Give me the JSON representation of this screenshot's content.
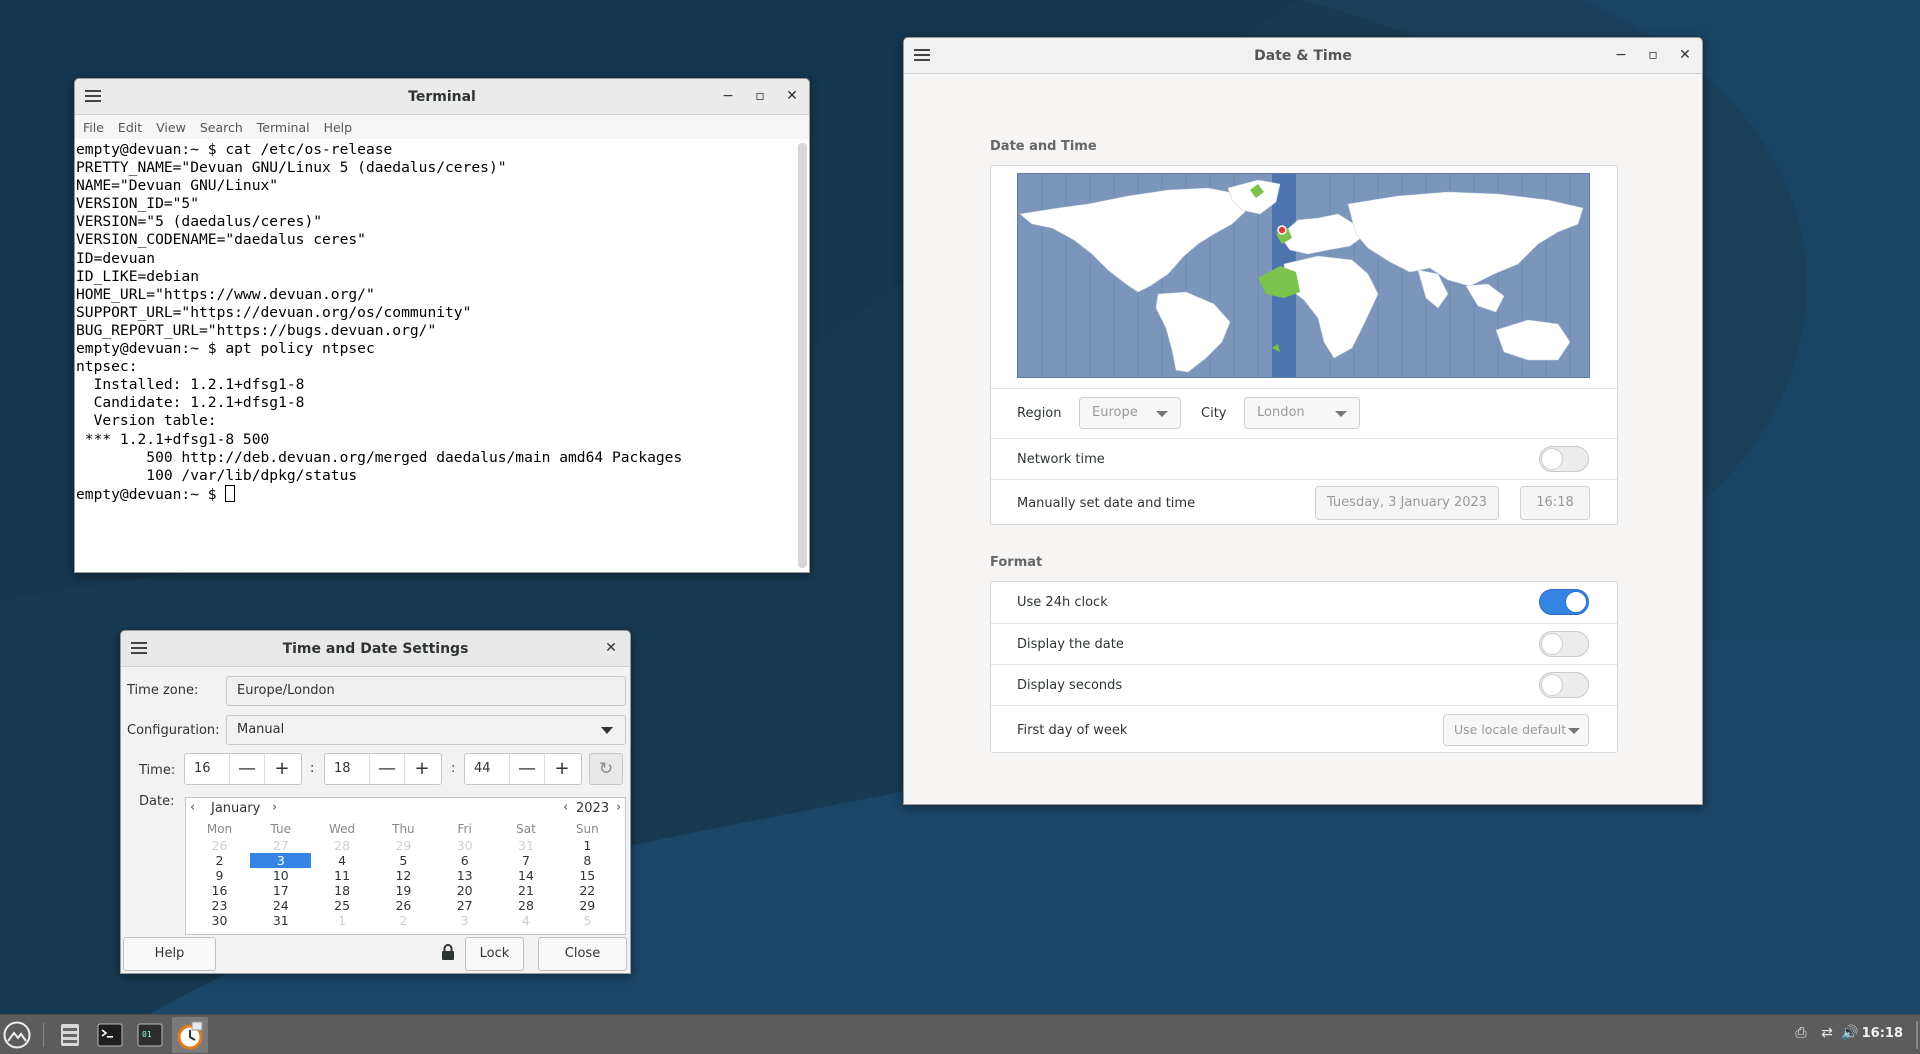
{
  "terminal": {
    "title": "Terminal",
    "menu": [
      "File",
      "Edit",
      "View",
      "Search",
      "Terminal",
      "Help"
    ],
    "lines": [
      "empty@devuan:~ $ cat /etc/os-release",
      "PRETTY_NAME=\"Devuan GNU/Linux 5 (daedalus/ceres)\"",
      "NAME=\"Devuan GNU/Linux\"",
      "VERSION_ID=\"5\"",
      "VERSION=\"5 (daedalus/ceres)\"",
      "VERSION_CODENAME=\"daedalus ceres\"",
      "ID=devuan",
      "ID_LIKE=debian",
      "HOME_URL=\"https://www.devuan.org/\"",
      "SUPPORT_URL=\"https://devuan.org/os/community\"",
      "BUG_REPORT_URL=\"https://bugs.devuan.org/\"",
      "empty@devuan:~ $ apt policy ntpsec",
      "ntpsec:",
      "  Installed: 1.2.1+dfsg1-8",
      "  Candidate: 1.2.1+dfsg1-8",
      "  Version table:",
      " *** 1.2.1+dfsg1-8 500",
      "        500 http://deb.devuan.org/merged daedalus/main amd64 Packages",
      "        100 /var/lib/dpkg/status"
    ],
    "prompt": "empty@devuan:~ $ "
  },
  "gnome_dt": {
    "title": "Date & Time",
    "section_date": "Date and Time",
    "region_label": "Region",
    "region_value": "Europe",
    "city_label": "City",
    "city_value": "London",
    "network_time_label": "Network time",
    "network_time_on": false,
    "manual_label": "Manually set date and time",
    "manual_date": "Tuesday, 3 January 2023",
    "manual_time": "16:18",
    "section_format": "Format",
    "use24_label": "Use 24h clock",
    "use24_on": true,
    "display_date_label": "Display the date",
    "display_date_on": false,
    "display_seconds_label": "Display seconds",
    "display_seconds_on": false,
    "first_day_label": "First day of week",
    "first_day_value": "Use locale default"
  },
  "tds": {
    "title": "Time and Date Settings",
    "timezone_label": "Time zone:",
    "timezone_value": "Europe/London",
    "config_label": "Configuration:",
    "config_value": "Manual",
    "time_label": "Time:",
    "hour": "16",
    "minute": "18",
    "second": "44",
    "colon": ":",
    "minus": "—",
    "plus": "+",
    "date_label": "Date:",
    "month": "January",
    "year": "2023",
    "weekdays": [
      "Mon",
      "Tue",
      "Wed",
      "Thu",
      "Fri",
      "Sat",
      "Sun"
    ],
    "weeks": [
      [
        "26",
        "27",
        "28",
        "29",
        "30",
        "31",
        "1"
      ],
      [
        "2",
        "3",
        "4",
        "5",
        "6",
        "7",
        "8"
      ],
      [
        "9",
        "10",
        "11",
        "12",
        "13",
        "14",
        "15"
      ],
      [
        "16",
        "17",
        "18",
        "19",
        "20",
        "21",
        "22"
      ],
      [
        "23",
        "24",
        "25",
        "26",
        "27",
        "28",
        "29"
      ],
      [
        "30",
        "31",
        "1",
        "2",
        "3",
        "4",
        "5"
      ]
    ],
    "selected_day": "3",
    "help_label": "Help",
    "lock_label": "Lock",
    "close_label": "Close"
  },
  "taskbar": {
    "clock": "16:18"
  }
}
